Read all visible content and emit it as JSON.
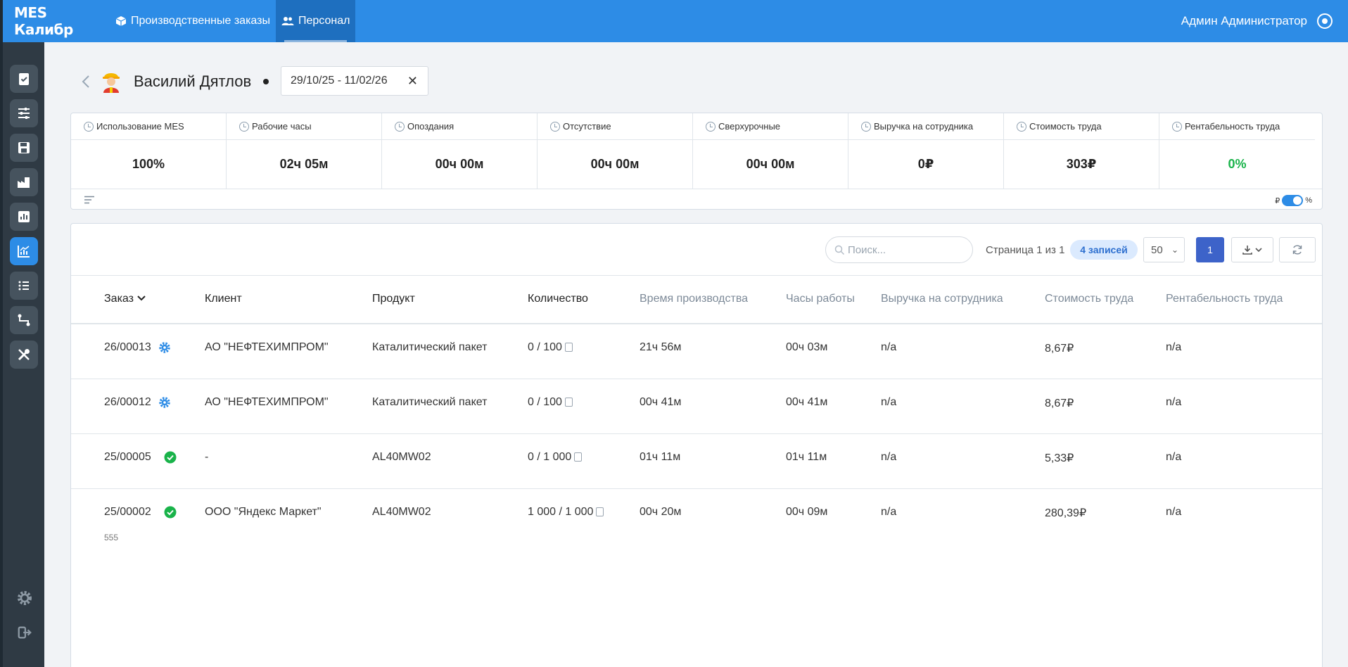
{
  "brand": "MES Калибр",
  "nav": [
    {
      "label": "Производственные заказы",
      "icon": "box-icon"
    },
    {
      "label": "Персонал",
      "icon": "users-icon"
    }
  ],
  "user": {
    "name": "Админ Администратор"
  },
  "person": {
    "name": "Василий Дятлов"
  },
  "daterange": "29/10/25 - 11/02/26",
  "kpis": [
    {
      "label": "Использование MES",
      "value": "100%"
    },
    {
      "label": "Рабочие часы",
      "value": "02ч 05м"
    },
    {
      "label": "Опоздания",
      "value": "00ч 00м"
    },
    {
      "label": "Отсутствие",
      "value": "00ч 00м"
    },
    {
      "label": "Сверхурочные",
      "value": "00ч 00м"
    },
    {
      "label": "Выручка на сотрудника",
      "value": "0₽"
    },
    {
      "label": "Стоимость труда",
      "value": "303₽"
    },
    {
      "label": "Рентабельность труда",
      "value": "0%"
    }
  ],
  "toggle": {
    "left": "₽",
    "right": "%"
  },
  "toolbar": {
    "search_placeholder": "Поиск...",
    "page_info": "Страница 1 из 1",
    "records": "4 записей",
    "per_page": "50",
    "current_page": "1"
  },
  "columns": [
    "Заказ",
    "Клиент",
    "Продукт",
    "Количество",
    "Время производства",
    "Часы работы",
    "Выручка на сотрудника",
    "Стоимость труда",
    "Рентабельность труда"
  ],
  "rows": [
    {
      "order": "26/00013",
      "status": "gear-icon",
      "client": "АО \"НЕФТЕХИМПРОМ\"",
      "product": "Каталитический пакет",
      "qty": "0 / 100",
      "prod_time": "21ч 56м",
      "work_hours": "00ч 03м",
      "revenue": "n/a",
      "labor_cost": "8,67₽",
      "profitability": "n/a",
      "note": ""
    },
    {
      "order": "26/00012",
      "status": "gear-icon",
      "client": "АО \"НЕФТЕХИМПРОМ\"",
      "product": "Каталитический пакет",
      "qty": "0 / 100",
      "prod_time": "00ч 41м",
      "work_hours": "00ч 41м",
      "revenue": "n/a",
      "labor_cost": "8,67₽",
      "profitability": "n/a",
      "note": ""
    },
    {
      "order": "25/00005",
      "status": "check-icon",
      "client": "-",
      "product": "AL40MW02",
      "qty": "0 / 1 000",
      "prod_time": "01ч 11м",
      "work_hours": "01ч 11м",
      "revenue": "n/a",
      "labor_cost": "5,33₽",
      "profitability": "n/a",
      "note": ""
    },
    {
      "order": "25/00002",
      "status": "check-icon",
      "client": "ООО \"Яндекс Маркет\"",
      "product": "AL40MW02",
      "qty": "1 000 / 1 000",
      "prod_time": "00ч 20м",
      "work_hours": "00ч 09м",
      "revenue": "n/a",
      "labor_cost": "280,39₽",
      "profitability": "n/a",
      "note": "555"
    }
  ],
  "colors": {
    "primary": "#2d8ce6",
    "sidebar": "#2f3a44",
    "success": "#19b34a",
    "page_btn": "#3d63c9"
  }
}
